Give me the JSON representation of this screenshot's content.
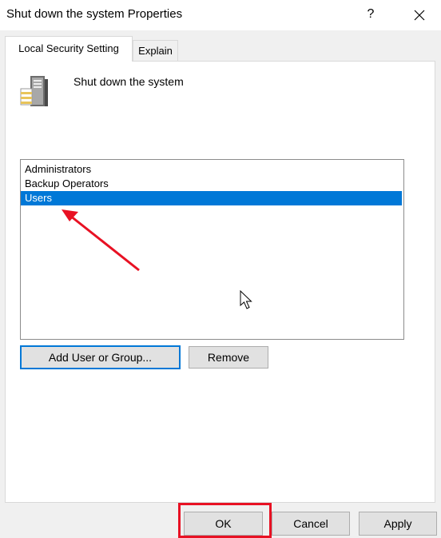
{
  "window": {
    "title": "Shut down the system Properties",
    "help_label": "?",
    "close_label": "✕"
  },
  "tabs": [
    {
      "label": "Local Security Setting",
      "active": true
    },
    {
      "label": "Explain",
      "active": false
    }
  ],
  "policy": {
    "name": "Shut down the system",
    "icon": "server-policy-icon"
  },
  "members": {
    "items": [
      {
        "label": "Administrators",
        "selected": false
      },
      {
        "label": "Backup Operators",
        "selected": false
      },
      {
        "label": "Users",
        "selected": true
      }
    ]
  },
  "buttons": {
    "add": "Add User or Group...",
    "remove": "Remove",
    "ok": "OK",
    "cancel": "Cancel",
    "apply": "Apply"
  },
  "colors": {
    "selection": "#0078d7",
    "annotation": "#e81123"
  }
}
